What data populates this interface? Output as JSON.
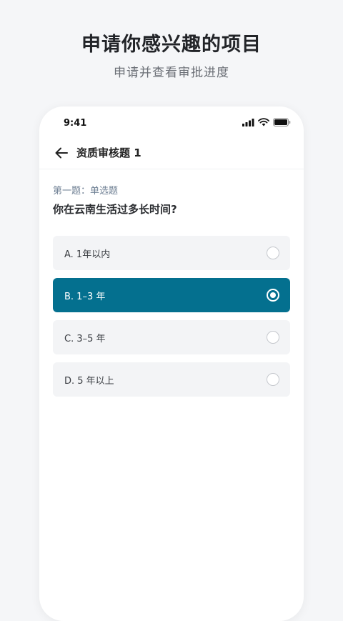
{
  "promo": {
    "title": "申请你感兴趣的项目",
    "subtitle": "申请并查看审批进度"
  },
  "status_bar": {
    "time": "9:41",
    "icons": [
      "signal-icon",
      "wifi-icon",
      "battery-icon"
    ]
  },
  "nav": {
    "back_icon": "arrow-left-icon",
    "title": "资质审核题 1"
  },
  "question": {
    "type": "第一题：单选题",
    "text": "你在云南生活过多长时间?"
  },
  "options": [
    {
      "label": "A.  1年以内",
      "selected": false
    },
    {
      "label": "B.  1–3 年",
      "selected": true
    },
    {
      "label": "C.  3–5 年",
      "selected": false
    },
    {
      "label": "D.  5 年以上",
      "selected": false
    }
  ],
  "colors": {
    "accent": "#04708f",
    "background": "#f5f6f8",
    "option_bg": "#f3f4f6"
  }
}
